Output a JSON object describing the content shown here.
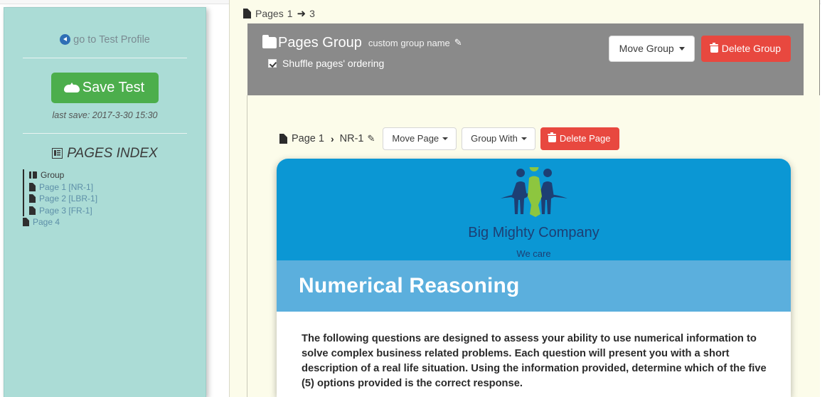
{
  "sidebar": {
    "profile_link": "go to Test Profile",
    "profile_link_icon": "circle-left-arrow-icon",
    "save_button": "Save Test",
    "save_button_icon": "cloud-upload-icon",
    "last_save": "last save: 2017-3-30 15:30",
    "pages_index_title": "PAGES INDEX",
    "pages_index_icon": "list-icon",
    "tree": {
      "group": {
        "label": "Group",
        "icon": "folder-icon"
      },
      "grouped_pages": [
        {
          "label": "Page 1 [NR-1]",
          "icon": "file-icon"
        },
        {
          "label": "Page 2 [LBR-1]",
          "icon": "file-icon"
        },
        {
          "label": "Page 3 [FR-1]",
          "icon": "file-icon"
        }
      ],
      "ungrouped_pages": [
        {
          "label": "Page 4",
          "icon": "file-icon"
        }
      ]
    }
  },
  "breadcrumb": {
    "icon": "pages-icon",
    "label": "Pages",
    "from": "1",
    "arrow": "➜",
    "to": "3"
  },
  "group_header": {
    "folder_icon": "folder-icon",
    "title": "Pages Group",
    "subtitle": "custom group name",
    "edit_icon": "pencil-icon",
    "checkbox_label": "Shuffle pages' ordering",
    "checkbox_checked": true,
    "move_group_button": "Move Group",
    "delete_group_button": "Delete Group",
    "delete_icon": "trash-icon",
    "background_color": "#8a8a8a"
  },
  "page_toolbar": {
    "file_icon": "file-icon",
    "page_label": "Page 1",
    "separator": "›",
    "page_code": "NR-1",
    "edit_icon": "pencil-icon",
    "move_page_button": "Move Page",
    "group_with_button": "Group With",
    "delete_page_button": "Delete Page",
    "delete_icon": "trash-icon"
  },
  "test_card": {
    "logo": {
      "company_name": "Big Mighty Company",
      "tagline": "We care",
      "header_color": "#0b97d4",
      "figure_colors": [
        "#1d3f74",
        "#8dc63f",
        "#1d3f74"
      ]
    },
    "band": {
      "title": "Numerical Reasoning",
      "color": "#5bafdd"
    },
    "body_text": "The following questions are designed to assess your ability to use numerical information to solve complex business related problems. Each question will present you with a short description of a real life situation. Using the information provided, determine which of the five (5) options provided is the correct response."
  },
  "colors": {
    "sidebar_bg": "#abdcd6",
    "content_bg": "#fcfcea",
    "accent_green": "#4cae4c",
    "accent_red": "#e8483f",
    "link_blue": "#5d8fa8"
  }
}
